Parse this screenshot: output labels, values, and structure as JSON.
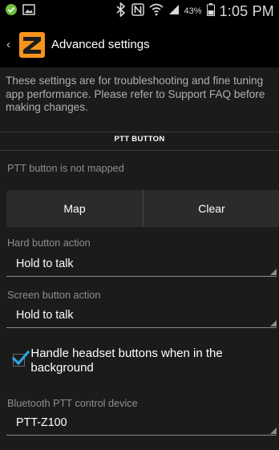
{
  "status_bar": {
    "battery_percent": "43%",
    "time": "1:05 PM",
    "icons": [
      "check-circle-icon",
      "image-icon",
      "bluetooth-icon",
      "nfc-icon",
      "wifi-icon",
      "signal-icon",
      "battery-icon"
    ]
  },
  "action_bar": {
    "back_glyph": "‹",
    "title": "Advanced settings",
    "logo_letter": "Z"
  },
  "intro_text": "These settings are for troubleshooting and fine tuning app performance. Please refer to Support FAQ before making changes.",
  "ptt_section": {
    "header": "PTT BUTTON",
    "status": "PTT button is not mapped",
    "map_label": "Map",
    "clear_label": "Clear"
  },
  "hard_button": {
    "label": "Hard button action",
    "value": "Hold to talk"
  },
  "screen_button": {
    "label": "Screen button action",
    "value": "Hold to talk"
  },
  "headset": {
    "checked": true,
    "label": "Handle headset buttons when in the background"
  },
  "bluetooth": {
    "label": "Bluetooth PTT control device",
    "value": "PTT-Z100"
  },
  "colors": {
    "accent": "#2aa3dd",
    "logo_orange": "#f7941d",
    "background": "#1b1b1b"
  }
}
